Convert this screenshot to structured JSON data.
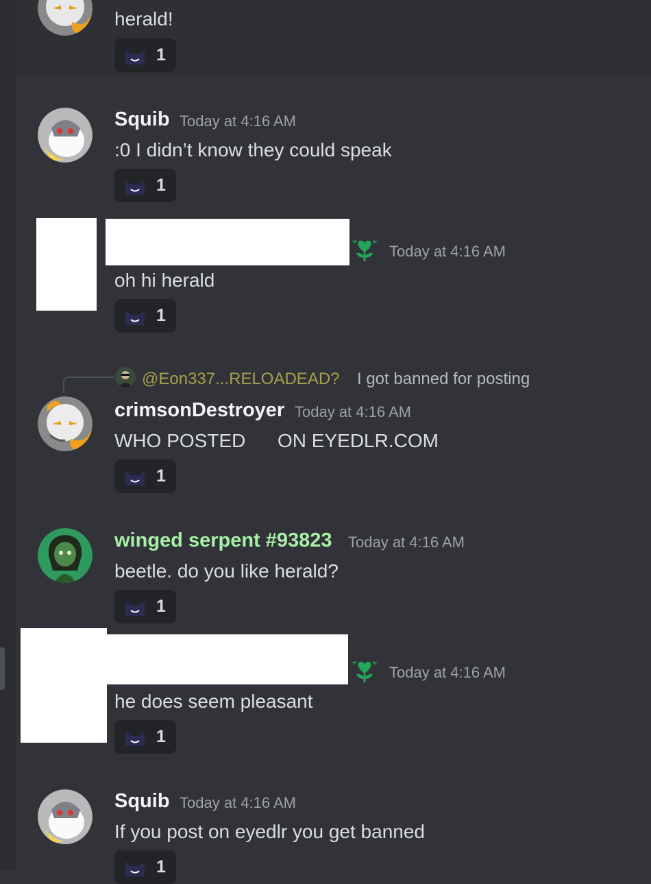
{
  "reaction_count": "1",
  "messages": [
    {
      "text": "herald!"
    },
    {
      "author": "Squib",
      "timestamp": "Today at 4:16 AM",
      "text": ":0 I didn’t know they could speak"
    },
    {
      "timestamp": "Today at 4:16 AM",
      "text": "oh hi herald"
    },
    {
      "author": "crimsonDestroyer",
      "timestamp": "Today at 4:16 AM",
      "text": "WHO POSTED      ON EYEDLR.COM",
      "reply": {
        "mention": "@Eon337...RELOADEAD?",
        "text": "I got banned for posting"
      }
    },
    {
      "author": "winged serpent #93823",
      "timestamp": "Today at 4:16 AM",
      "text": "beetle. do you like herald?",
      "name_color": "#a8f0a8"
    },
    {
      "timestamp": "Today at 4:16 AM",
      "text": "he does seem pleasant"
    },
    {
      "author": "Squib",
      "timestamp": "Today at 4:16 AM",
      "text": "If you post on eyedlr you get banned"
    }
  ],
  "colors": {
    "background": "#313338",
    "author_default": "#f2f3f5",
    "role_badge": "#23a55a",
    "reply_mention": "#a6a14b"
  },
  "icons": {
    "reaction_emoji": "cat-smile-emoji",
    "role_badge": "heart-sprout-icon"
  }
}
